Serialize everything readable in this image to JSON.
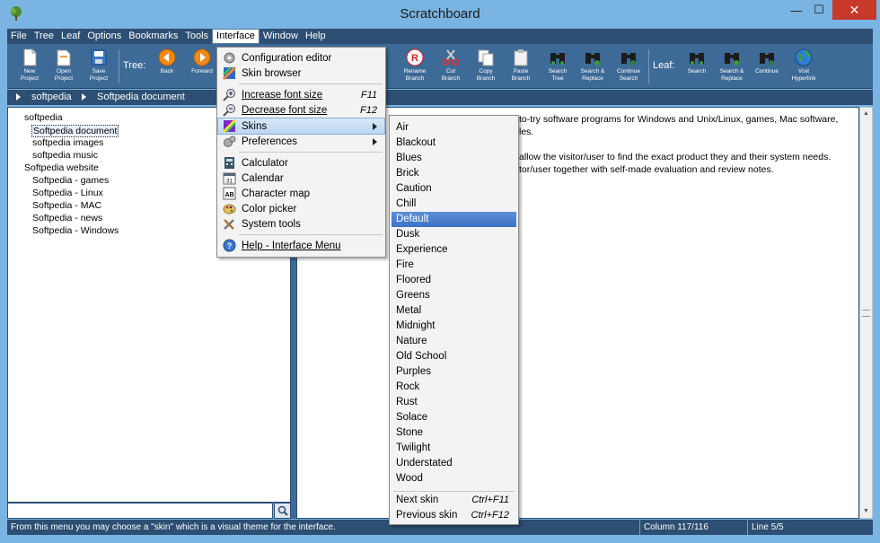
{
  "window": {
    "title": "Scratchboard",
    "min_glyph": "—",
    "max_glyph": "☐",
    "close_glyph": "✕"
  },
  "menubar": [
    {
      "id": "file",
      "label": "File"
    },
    {
      "id": "tree",
      "label": "Tree"
    },
    {
      "id": "leaf",
      "label": "Leaf"
    },
    {
      "id": "options",
      "label": "Options"
    },
    {
      "id": "bookmarks",
      "label": "Bookmarks"
    },
    {
      "id": "tools",
      "label": "Tools"
    },
    {
      "id": "interface",
      "label": "Interface",
      "active": true
    },
    {
      "id": "window",
      "label": "Window"
    },
    {
      "id": "help",
      "label": "Help"
    }
  ],
  "toolbar": {
    "tree_label": "Tree:",
    "leaf_label": "Leaf:",
    "buttons": {
      "new_project": "New\nProject",
      "open_project": "Open\nProject",
      "save_project": "Save\nProject",
      "back": "Back",
      "forward": "Forward",
      "rename_branch": "Rename\nBranch",
      "cut_branch": "Cut\nBranch",
      "copy_branch": "Copy\nBranch",
      "paste_branch": "Paste\nBranch",
      "search_tree": "Search\nTree",
      "search_replace": "Search &\nReplace",
      "continue_search": "Continue\nSearch",
      "leaf_search": "Search",
      "leaf_search_replace": "Search &\nReplace",
      "leaf_continue": "Continue",
      "visit_hyperlink": "Visit\nHyperlink"
    }
  },
  "breadcrumb": {
    "items": [
      "softpedia",
      "Softpedia document"
    ]
  },
  "tree": {
    "items": [
      {
        "label": "softpedia",
        "level": 0
      },
      {
        "label": "Softpedia document",
        "level": 1,
        "selected": true
      },
      {
        "label": "softpedia images",
        "level": 1
      },
      {
        "label": "softpedia music",
        "level": 1
      },
      {
        "label": "Softpedia website",
        "level": 0
      },
      {
        "label": "Softpedia - games",
        "level": 1
      },
      {
        "label": "Softpedia - Linux",
        "level": 1
      },
      {
        "label": "Softpedia - MAC",
        "level": 1
      },
      {
        "label": "Softpedia - news",
        "level": 1
      },
      {
        "label": "Softpedia - Windows",
        "level": 1
      }
    ],
    "search_value": ""
  },
  "document": {
    "lines": [
      "to-try software programs for Windows and Unix/Linux, games, Mac software,",
      "les.",
      "allow the visitor/user to find the exact product they and their system needs.",
      "tor/user together with self-made evaluation and review notes."
    ]
  },
  "interface_menu": {
    "items": {
      "config_editor": "Configuration editor",
      "skin_browser": "Skin browser",
      "increase_font": "Increase font size",
      "increase_font_sc": "F11",
      "decrease_font": "Decrease font size",
      "decrease_font_sc": "F12",
      "skins": "Skins",
      "preferences": "Preferences",
      "calculator": "Calculator",
      "calendar": "Calendar",
      "character_map": "Character map",
      "color_picker": "Color picker",
      "system_tools": "System tools",
      "help_interface": "Help - Interface Menu"
    }
  },
  "skins_menu": {
    "skins": [
      "Air",
      "Blackout",
      "Blues",
      "Brick",
      "Caution",
      "Chill",
      "Default",
      "Dusk",
      "Experience",
      "Fire",
      "Floored",
      "Greens",
      "Metal",
      "Midnight",
      "Nature",
      "Old School",
      "Purples",
      "Rock",
      "Rust",
      "Solace",
      "Stone",
      "Twilight",
      "Understated",
      "Wood"
    ],
    "selected": "Default",
    "next_skin": "Next skin",
    "next_skin_sc": "Ctrl+F11",
    "prev_skin": "Previous skin",
    "prev_skin_sc": "Ctrl+F12"
  },
  "status": {
    "message": "From this menu you may choose a \"skin\" which is a visual theme for the interface.",
    "column": "Column 117/116",
    "line": "Line 5/5"
  },
  "colors": {
    "title_bg": "#7ab4e2",
    "panel_dark": "#2c4f73",
    "toolbar_bg": "#3d6a97",
    "close_red": "#c7392b",
    "selection_blue": "#3d72c4"
  }
}
